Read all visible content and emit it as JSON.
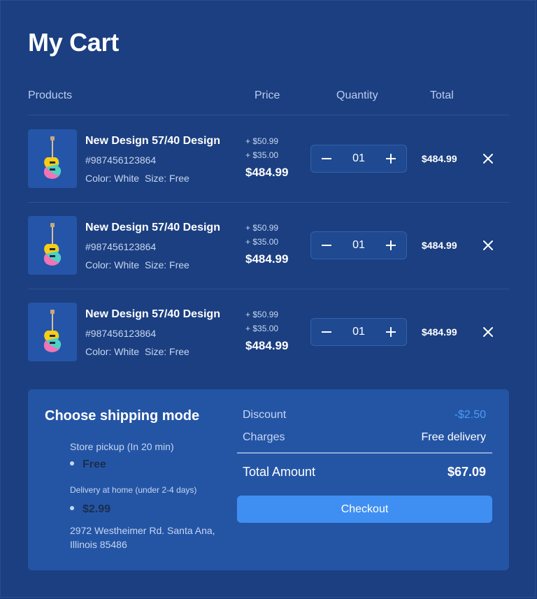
{
  "page": {
    "title": "My Cart"
  },
  "table": {
    "headers": {
      "products": "Products",
      "price": "Price",
      "quantity": "Quantity",
      "total": "Total"
    }
  },
  "items": [
    {
      "name": "New Design 57/40 Design",
      "sku": "#987456123864",
      "color_label": "Color: White",
      "size_label": "Size: Free",
      "addon1": "+ $50.99",
      "addon2": "+ $35.00",
      "price": "$484.99",
      "quantity": "01",
      "total": "$484.99",
      "image_icon": "guitar-icon"
    },
    {
      "name": "New Design 57/40 Design",
      "sku": "#987456123864",
      "color_label": "Color: White",
      "size_label": "Size: Free",
      "addon1": "+ $50.99",
      "addon2": "+ $35.00",
      "price": "$484.99",
      "quantity": "01",
      "total": "$484.99",
      "image_icon": "guitar-icon"
    },
    {
      "name": "New Design 57/40 Design",
      "sku": "#987456123864",
      "color_label": "Color: White",
      "size_label": "Size: Free",
      "addon1": "+ $50.99",
      "addon2": "+ $35.00",
      "price": "$484.99",
      "quantity": "01",
      "total": "$484.99",
      "image_icon": "guitar-icon"
    }
  ],
  "shipping": {
    "title": "Choose shipping mode",
    "options": [
      {
        "label": "Store pickup (In 20 min)",
        "value": "Free"
      },
      {
        "label": "Delivery at home (under 2-4 days)",
        "value": "$2.99"
      }
    ],
    "address": "2972 Westheimer Rd. Santa Ana, Illinois 85486"
  },
  "summary": {
    "discount_label": "Discount",
    "discount_value": "-$2.50",
    "charges_label": "Charges",
    "charges_value": "Free delivery",
    "total_label": "Total Amount",
    "total_value": "$67.09",
    "checkout_label": "Checkout"
  },
  "colors": {
    "background": "#1b3f80",
    "panel": "#2455a5",
    "accent": "#3f8ff2",
    "discount": "#4a9bf5"
  }
}
